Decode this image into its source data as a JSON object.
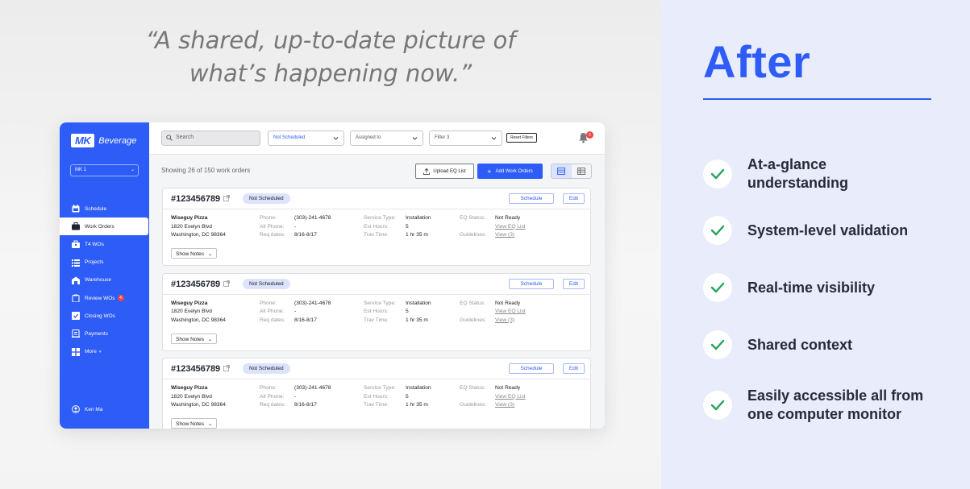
{
  "quote": {
    "line1": "“A shared, up-to-date picture of",
    "line2": "what’s happening now.”"
  },
  "after": {
    "title": "After",
    "accent": "#2d5cf6",
    "check_color": "#22a35a",
    "benefits": [
      {
        "line1": "At-a-glance",
        "line2": "understanding"
      },
      {
        "line1": "System-level validation",
        "line2": ""
      },
      {
        "line1": "Real-time visibility",
        "line2": ""
      },
      {
        "line1": "Shared context",
        "line2": ""
      },
      {
        "line1": "Easily accessible all from",
        "line2": "one computer monitor"
      }
    ]
  },
  "app": {
    "logo": {
      "mark": "MK",
      "name": "Beverage"
    },
    "org_select": "MK 1",
    "nav": [
      {
        "label": "Schedule",
        "icon": "calendar-icon"
      },
      {
        "label": "Work Orders",
        "icon": "briefcase-icon",
        "active": true
      },
      {
        "label": "T4 WOs",
        "icon": "toolbox-icon"
      },
      {
        "label": "Projects",
        "icon": "list-icon"
      },
      {
        "label": "Warehouse",
        "icon": "warehouse-icon"
      },
      {
        "label": "Review WOs",
        "icon": "clipboard-icon",
        "badge": "4"
      },
      {
        "label": "Closing WOs",
        "icon": "checkbox-icon"
      },
      {
        "label": "Payments",
        "icon": "receipt-icon"
      },
      {
        "label": "More",
        "icon": "grid-icon",
        "chevron": "▾"
      }
    ],
    "user": "Ken Ma",
    "topbar": {
      "search_placeholder": "Search",
      "filter_schedule": "Not Scheduled",
      "filter_assigned": "Assigned to",
      "filter_3": "Filter 3",
      "reset": "Reset Filters",
      "notification_count": "2"
    },
    "showing": "Showing 26 of 150 work orders",
    "upload_btn": "Upload EQ List",
    "add_btn": "Add Work Orders",
    "card": {
      "wo_number": "#123456789",
      "status": "Not Scheduled",
      "schedule_btn": "Schedule",
      "edit_btn": "Edit",
      "customer": "Wiseguy Pizza",
      "address1": "1820 Evelyn Blvd",
      "address2": "Washington, DC 98364",
      "phone_label": "Phone:",
      "phone": "(303)-241-4678",
      "alt_phone_label": "Alt Phone:",
      "alt_phone": "-",
      "req_dates_label": "Req dates:",
      "req_dates": "8/16-8/17",
      "service_type_label": "Service Type:",
      "service_type": "Installation",
      "est_hours_label": "Est Hours:",
      "est_hours": "5",
      "trav_time_label": "Trav Time:",
      "trav_time": "1 hr 35 m",
      "eq_status_label": "EQ Status:",
      "eq_status": "Not Ready",
      "eq_list_link": "View EQ List",
      "guidelines_label": "Guidelines:",
      "guidelines_link": "View (3)",
      "notes_btn": "Show Notes"
    }
  }
}
